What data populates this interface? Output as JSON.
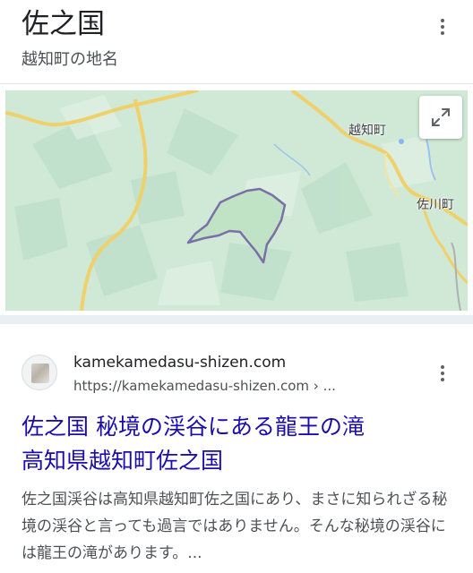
{
  "header": {
    "title": "佐之国",
    "subtitle": "越知町の地名",
    "menu_icon": "more-vert-icon"
  },
  "map": {
    "labels": {
      "ochi": "越知町",
      "sakawa": "佐川町"
    },
    "expand_icon": "expand-icon",
    "colors": {
      "land": "#cfe9d6",
      "road": "#f5d97a",
      "boundary": "#7b6fa8",
      "river": "#8ab4f8"
    }
  },
  "result": {
    "site_name": "kamekamedasu-shizen.com",
    "url": "https://kamekamedasu-shizen.com",
    "url_suffix": " › ...",
    "title_line1": "佐之国 秘境の渓谷にある龍王の滝",
    "title_line2": "高知県越知町佐之国",
    "snippet": "佐之国渓谷は高知県越知町佐之国にあり、まさに知られざる秘境の渓谷と言っても過言ではありません。そんな秘境の渓谷には龍王の滝があります。...",
    "menu_icon": "more-vert-icon",
    "link_color": "#1a0dab"
  }
}
